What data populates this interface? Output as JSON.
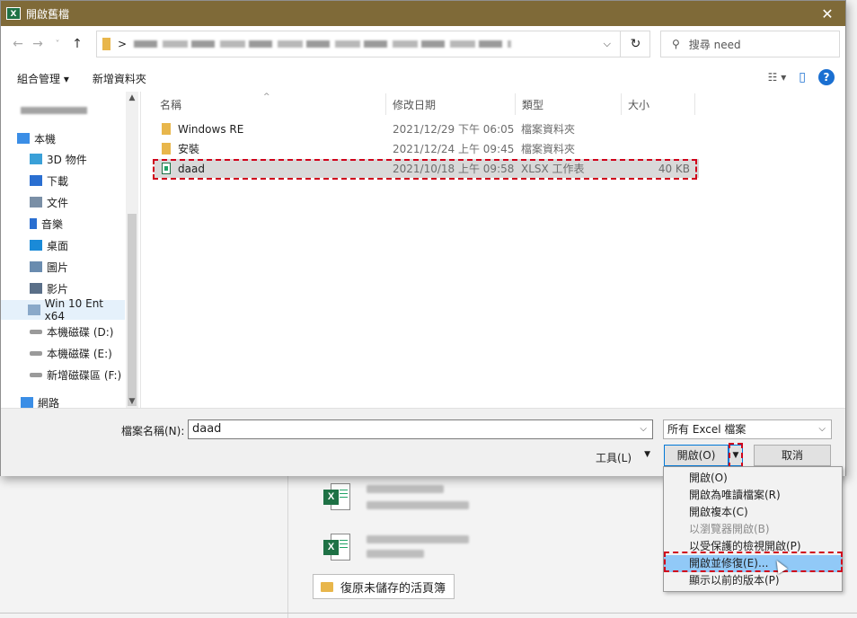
{
  "window": {
    "title": "開啟舊檔",
    "app_icon": "X",
    "close_glyph": "✕"
  },
  "nav": {
    "back_glyph": "←",
    "forward_glyph": "→",
    "recent_glyph": "˅",
    "up_glyph": "↑",
    "address_sep": ">",
    "address_dropdown": "⌵",
    "refresh_glyph": "↻"
  },
  "search": {
    "placeholder": "搜尋 need",
    "icon_glyph": "⚲"
  },
  "toolbar": {
    "organize": "組合管理 ▾",
    "new_folder": "新增資料夾",
    "view_glyph": "☷ ▾",
    "pane_glyph": "▯",
    "help": "?"
  },
  "sidebar": {
    "items": [
      {
        "label": "本機",
        "icon": "pc-icon",
        "color": "#3b8ee6"
      },
      {
        "label": "3D 物件",
        "icon": "cube-icon",
        "color": "#3aa0d8"
      },
      {
        "label": "下載",
        "icon": "download-icon",
        "color": "#2a6fd1"
      },
      {
        "label": "文件",
        "icon": "document-icon",
        "color": "#7a8fa6"
      },
      {
        "label": "音樂",
        "icon": "music-icon",
        "color": "#2a6fd1"
      },
      {
        "label": "桌面",
        "icon": "desktop-icon",
        "color": "#1a8ad8"
      },
      {
        "label": "圖片",
        "icon": "pictures-icon",
        "color": "#6a8caf"
      },
      {
        "label": "影片",
        "icon": "video-icon",
        "color": "#5a6f88"
      },
      {
        "label": "Win 10 Ent x64",
        "icon": "network-drive-icon",
        "color": "#8aa9c9"
      },
      {
        "label": "本機磁碟 (D:)",
        "icon": "drive-icon",
        "color": "#9a9a9a"
      },
      {
        "label": "本機磁碟 (E:)",
        "icon": "drive-icon",
        "color": "#9a9a9a"
      },
      {
        "label": "新增磁碟區 (F:)",
        "icon": "drive-icon",
        "color": "#9a9a9a"
      },
      {
        "label": "網路",
        "icon": "network-icon",
        "color": "#3b8ee6"
      }
    ]
  },
  "columns": {
    "name": "名稱",
    "modified": "修改日期",
    "type": "類型",
    "size": "大小"
  },
  "files": [
    {
      "name": "Windows RE",
      "modified": "2021/12/29 下午 06:05",
      "type": "檔案資料夾",
      "size": "",
      "kind": "folder"
    },
    {
      "name": "安裝",
      "modified": "2021/12/24 上午 09:45",
      "type": "檔案資料夾",
      "size": "",
      "kind": "folder"
    },
    {
      "name": "daad",
      "modified": "2021/10/18 上午 09:58",
      "type": "XLSX 工作表",
      "size": "40 KB",
      "kind": "xlsx"
    }
  ],
  "footer": {
    "filename_label": "檔案名稱(N):",
    "filename_value": "daad",
    "filetype_value": "所有 Excel 檔案",
    "tools_label": "工具(L)",
    "tools_caret": "▼",
    "open_label": "開啟(O)",
    "open_caret": "▼",
    "cancel_label": "取消",
    "dropdown_glyph": "⌵"
  },
  "open_menu": {
    "items": [
      {
        "label": "開啟(O)",
        "state": "normal"
      },
      {
        "label": "開啟為唯讀檔案(R)",
        "state": "normal"
      },
      {
        "label": "開啟複本(C)",
        "state": "normal"
      },
      {
        "label": "以瀏覽器開啟(B)",
        "state": "disabled"
      },
      {
        "label": "以受保護的檢視開啟(P)",
        "state": "normal"
      },
      {
        "label": "開啟並修復(E)...",
        "state": "active"
      },
      {
        "label": "顯示以前的版本(P)",
        "state": "normal"
      }
    ]
  },
  "background": {
    "restore_label": "復原未儲存的活頁簿",
    "xl_badge": "X"
  },
  "colors": {
    "title_bar": "#7f6a38",
    "highlight": "#d0021b",
    "menu_active": "#91c9f7",
    "accent": "#0078d7"
  }
}
